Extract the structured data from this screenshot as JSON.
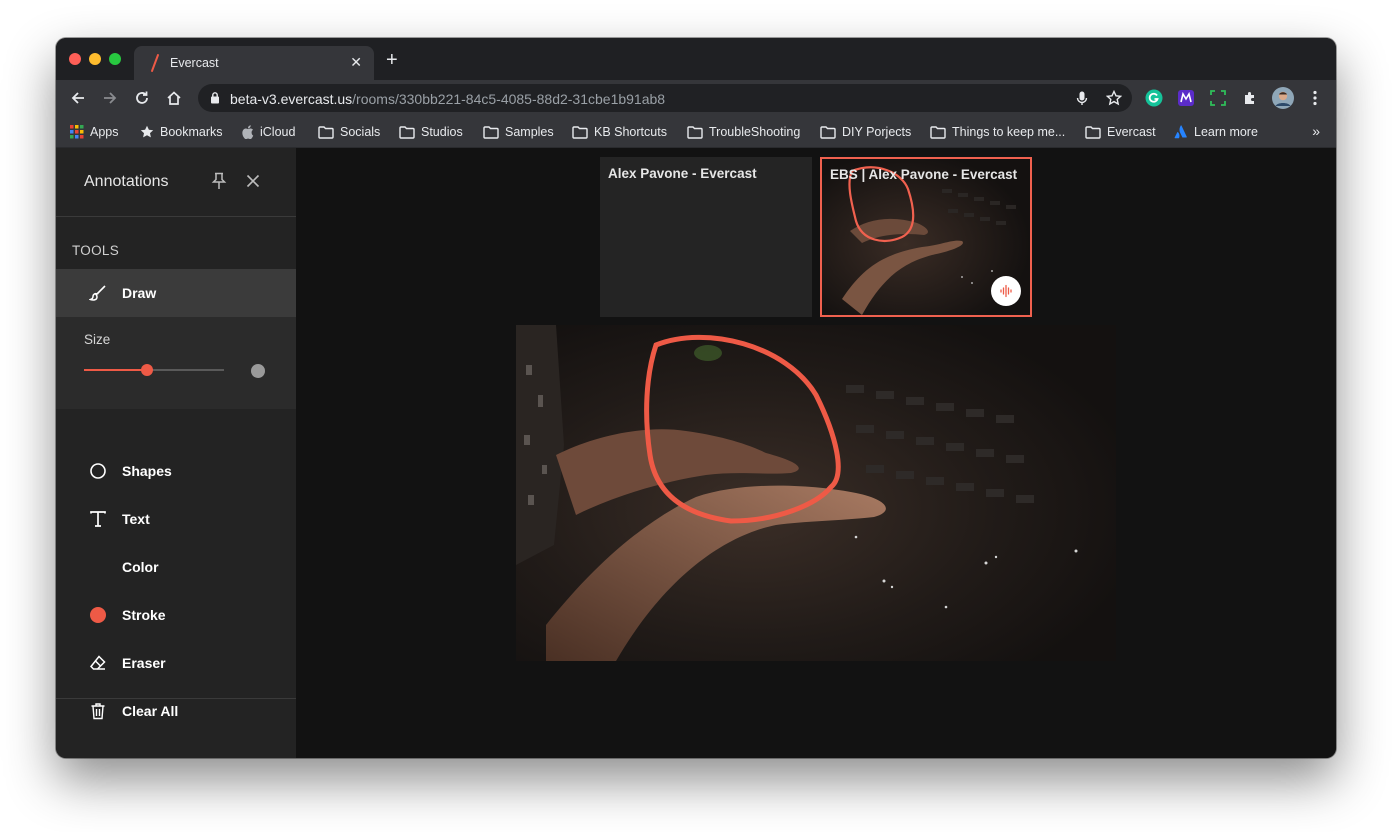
{
  "browser": {
    "tab_title": "Evercast",
    "url_host": "beta-v3.evercast.us",
    "url_path": "/rooms/330bb221-84c5-4085-88d2-31cbe1b91ab8",
    "bookmarks": [
      {
        "label": "Apps",
        "icon": "apps-grid-icon"
      },
      {
        "label": "Bookmarks",
        "icon": "star-icon"
      },
      {
        "label": "iCloud",
        "icon": "apple-icon"
      },
      {
        "label": "Socials",
        "icon": "folder-icon"
      },
      {
        "label": "Studios",
        "icon": "folder-icon"
      },
      {
        "label": "Samples",
        "icon": "folder-icon"
      },
      {
        "label": "KB Shortcuts",
        "icon": "folder-icon"
      },
      {
        "label": "TroubleShooting",
        "icon": "folder-icon"
      },
      {
        "label": "DIY Porjects",
        "icon": "folder-icon"
      },
      {
        "label": "Things to keep me...",
        "icon": "folder-icon"
      },
      {
        "label": "Evercast",
        "icon": "folder-icon"
      },
      {
        "label": "Learn more",
        "icon": "atlassian-icon"
      }
    ],
    "more": "»"
  },
  "sidebar": {
    "title": "Annotations",
    "tools_label": "TOOLS",
    "tools": [
      {
        "label": "Draw",
        "icon": "brush-icon",
        "active": true
      },
      {
        "label": "Shapes",
        "icon": "circle-outline-icon"
      },
      {
        "label": "Text",
        "icon": "text-icon"
      },
      {
        "label": "Color",
        "icon": ""
      },
      {
        "label": "Stroke",
        "icon": "stroke-dot-icon",
        "color": "#ee5a46"
      },
      {
        "label": "Eraser",
        "icon": "eraser-icon"
      },
      {
        "label": "Clear All",
        "icon": "trash-icon"
      }
    ],
    "size": {
      "label": "Size",
      "value": 0.45
    }
  },
  "participants": [
    {
      "label": "Alex Pavone - Evercast"
    },
    {
      "label": "EBS | Alex Pavone - Evercast",
      "active": true
    }
  ],
  "colors": {
    "accent": "#ee5a46",
    "background": "#121212",
    "sidebar": "#232323"
  }
}
